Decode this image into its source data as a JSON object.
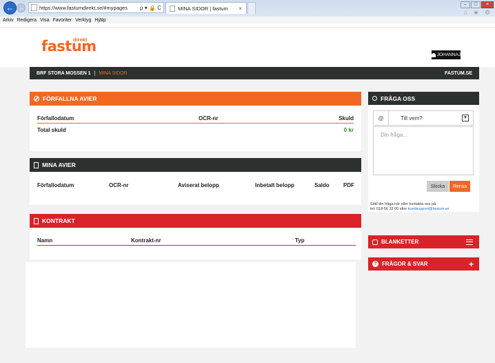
{
  "browser": {
    "url": "https://www.fastumdirekt.se/#mypages",
    "url_tools": "ρ ▾ 🔒 C",
    "tab_title": "MINA SIDOR | fastum",
    "tab_close": "×",
    "menu": [
      "Arkiv",
      "Redigera",
      "Visa",
      "Favoriter",
      "Verktyg",
      "Hjälp"
    ],
    "nav_back": "←",
    "nav_forward": "→",
    "win_min": "–",
    "win_max": "□",
    "win_close": "×",
    "toolbar_icons": "⌂ ★ ⚙"
  },
  "header": {
    "logo": "fastum",
    "logo_tag": "direkt",
    "user": "JOHANNAJ"
  },
  "navbar": {
    "crumb": "BRF STORA MOSSEN 1",
    "separator": "|",
    "current": "MINA SIDOR",
    "site_link": "FASTUM.SE"
  },
  "overdue": {
    "title": "FÖRFALLNA AVIER",
    "columns": [
      "Förfallodatum",
      "OCR-nr",
      "Skuld"
    ],
    "total_label": "Total skuld",
    "total_value": "0 kr"
  },
  "invoices": {
    "title": "MINA AVIER",
    "columns": [
      "Förfallodatum",
      "OCR-nr",
      "Aviserat belopp",
      "Inbetalt belopp",
      "Saldo",
      "PDF"
    ]
  },
  "contract": {
    "title": "KONTRAKT",
    "columns": [
      "Namn",
      "Kontrakt-nr",
      "Typ"
    ]
  },
  "question": {
    "title": "FRÅGA OSS",
    "at_symbol": "@",
    "select_value": "Till vem?",
    "select_arrow": "▾",
    "placeholder": "Din fråga...",
    "send": "Skicka",
    "clear": "Rensa",
    "help_line1": "Ställ din fråga här eller kontakta oss på:",
    "help_line2": "tel: 018-56 32 00 eller ",
    "help_email": "kundsupport@fastum.se"
  },
  "forms": {
    "title": "BLANKETTER"
  },
  "faq": {
    "title": "FRÅGOR & SVAR",
    "expand": "+",
    "icon": "?"
  },
  "colors": {
    "accent_orange": "#f26722",
    "accent_red": "#d8232a",
    "dark_bar": "#2c302e",
    "positive_green": "#2c8a23"
  }
}
